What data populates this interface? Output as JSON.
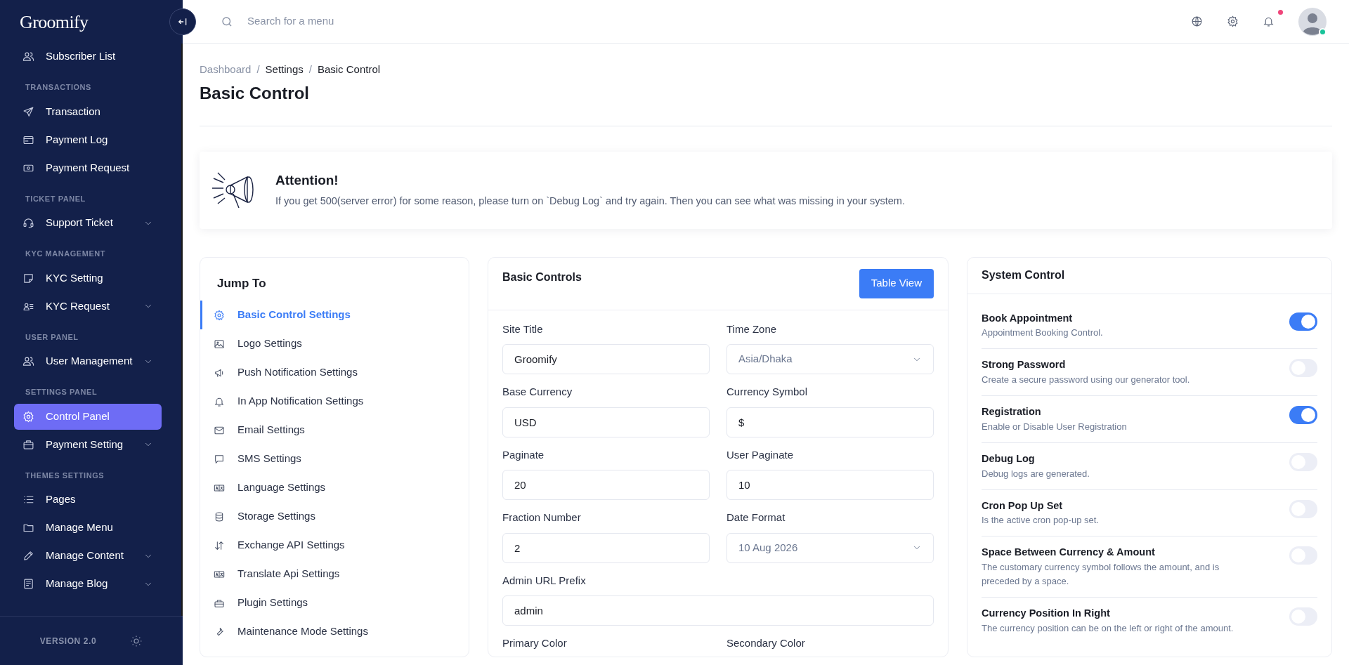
{
  "sidebar": {
    "logo": "Groomify",
    "sections": [
      {
        "items": [
          {
            "label": "Subscriber List",
            "selected": false,
            "has_submenu": false
          }
        ]
      },
      {
        "heading": "TRANSACTIONS",
        "items": [
          {
            "label": "Transaction",
            "selected": false,
            "has_submenu": false
          },
          {
            "label": "Payment Log",
            "selected": false,
            "has_submenu": false
          },
          {
            "label": "Payment Request",
            "selected": false,
            "has_submenu": false
          }
        ]
      },
      {
        "heading": "TICKET PANEL",
        "items": [
          {
            "label": "Support Ticket",
            "selected": false,
            "has_submenu": true
          }
        ]
      },
      {
        "heading": "KYC MANAGEMENT",
        "items": [
          {
            "label": "KYC Setting",
            "selected": false,
            "has_submenu": false
          },
          {
            "label": "KYC Request",
            "selected": false,
            "has_submenu": true
          }
        ]
      },
      {
        "heading": "USER PANEL",
        "items": [
          {
            "label": "User Management",
            "selected": false,
            "has_submenu": true
          }
        ]
      },
      {
        "heading": "SETTINGS PANEL",
        "items": [
          {
            "label": "Control Panel",
            "selected": true,
            "has_submenu": false
          },
          {
            "label": "Payment Setting",
            "selected": false,
            "has_submenu": true
          }
        ]
      },
      {
        "heading": "THEMES SETTINGS",
        "items": [
          {
            "label": "Pages",
            "selected": false,
            "has_submenu": false
          },
          {
            "label": "Manage Menu",
            "selected": false,
            "has_submenu": false
          },
          {
            "label": "Manage Content",
            "selected": false,
            "has_submenu": true
          },
          {
            "label": "Manage Blog",
            "selected": false,
            "has_submenu": true
          }
        ]
      }
    ],
    "version": "VERSION 2.0"
  },
  "topbar": {
    "search": {
      "placeholder": "Search for a menu"
    },
    "has_unread_notifications": true,
    "user_online": true
  },
  "breadcrumb": {
    "separator": "/",
    "items": [
      "Dashboard",
      "Settings",
      "Basic Control"
    ]
  },
  "page_title": "Basic Control",
  "alert": {
    "title": "Attention!",
    "message": "If you get 500(server error) for some reason, please turn on `Debug Log` and try again. Then you can see what was missing in your system."
  },
  "jump_to": {
    "title": "Jump To",
    "items": [
      {
        "label": "Basic Control Settings",
        "selected": true
      },
      {
        "label": "Logo Settings",
        "selected": false
      },
      {
        "label": "Push Notification Settings",
        "selected": false
      },
      {
        "label": "In App Notification Settings",
        "selected": false
      },
      {
        "label": "Email Settings",
        "selected": false
      },
      {
        "label": "SMS Settings",
        "selected": false
      },
      {
        "label": "Language Settings",
        "selected": false
      },
      {
        "label": "Storage Settings",
        "selected": false
      },
      {
        "label": "Exchange API Settings",
        "selected": false
      },
      {
        "label": "Translate Api Settings",
        "selected": false
      },
      {
        "label": "Plugin Settings",
        "selected": false
      },
      {
        "label": "Maintenance Mode Settings",
        "selected": false
      }
    ]
  },
  "basic_controls": {
    "title": "Basic Controls",
    "button": "Table View",
    "fields": [
      {
        "kind": "text",
        "label": "Site Title",
        "value": "Groomify"
      },
      {
        "kind": "select",
        "label": "Time Zone",
        "value": "Asia/Dhaka"
      },
      {
        "kind": "text",
        "label": "Base Currency",
        "value": "USD"
      },
      {
        "kind": "text",
        "label": "Currency Symbol",
        "value": "$"
      },
      {
        "kind": "text",
        "label": "Paginate",
        "value": "20"
      },
      {
        "kind": "text",
        "label": "User Paginate",
        "value": "10"
      },
      {
        "kind": "text",
        "label": "Fraction Number",
        "value": "2"
      },
      {
        "kind": "select",
        "label": "Date Format",
        "value": "10 Aug 2026"
      },
      {
        "kind": "wide",
        "label": "Admin URL Prefix",
        "value": "admin"
      },
      {
        "kind": "label",
        "label": "Primary Color"
      },
      {
        "kind": "label",
        "label": "Secondary Color"
      }
    ]
  },
  "system_control": {
    "title": "System Control",
    "items": [
      {
        "title": "Book Appointment",
        "description": "Appointment Booking Control.",
        "on": true
      },
      {
        "title": "Strong Password",
        "description": "Create a secure password using our generator tool.",
        "on": false
      },
      {
        "title": "Registration",
        "description": "Enable or Disable User Registration",
        "on": true
      },
      {
        "title": "Debug Log",
        "description": "Debug logs are generated.",
        "on": false
      },
      {
        "title": "Cron Pop Up Set",
        "description": "Is the active cron pop-up set.",
        "on": false
      },
      {
        "title": "Space Between Currency & Amount",
        "description": "The customary currency symbol follows the amount, and is preceded by a space.",
        "on": false
      },
      {
        "title": "Currency Position In Right",
        "description": "The currency position can be on the left or right of the amount.",
        "on": false
      }
    ]
  }
}
